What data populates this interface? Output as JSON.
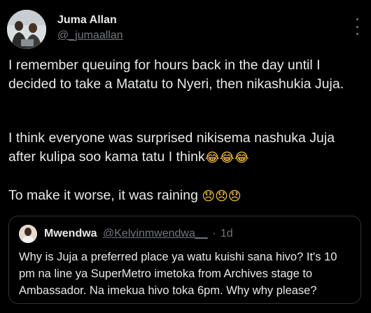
{
  "tweet": {
    "author_name": "Juma Allan",
    "author_handle": "@_jumaallan",
    "more_icon": "more-vertical-icon",
    "paragraphs": [
      "I remember queuing for hours back in the day until I decided to take a Matatu to Nyeri, then nikashukia Juja.",
      "I think everyone was surprised nikisema nashuka Juja after kulipa soo kama tatu I think",
      "To make it worse, it was raining"
    ],
    "emojis_p2": "😂😂😂",
    "emojis_p3": "😞😞😞"
  },
  "quote": {
    "author_name": "Mwendwa",
    "author_handle": "@Kelvinmwendwa__",
    "separator": "·",
    "time": "1d",
    "text": "Why is Juja a preferred place ya watu kuishi sana hivo? It's 10 pm na line ya SuperMetro imetoka from Archives stage to Ambassador. Na imekua hivo toka 6pm. Why why please?"
  },
  "colors": {
    "background": "#000000",
    "primary_text": "#e7e9ea",
    "secondary_text": "#71767b",
    "border": "#2f3336"
  }
}
